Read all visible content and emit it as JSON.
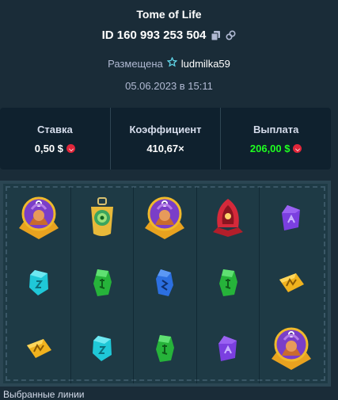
{
  "game": {
    "title": "Tome of Life",
    "bet_id": "ID 160 993 253 504",
    "placed_label": "Размещена",
    "user": "ludmilka59",
    "date": "05.06.2023 в 15:11"
  },
  "stats": {
    "bet_label": "Ставка",
    "bet_value": "0,50 $",
    "multiplier_label": "Коэффициент",
    "multiplier_value": "410,67×",
    "payout_label": "Выплата",
    "payout_value": "206,00 $"
  },
  "colors": {
    "background": "#1a2c38",
    "panel": "#0f212e",
    "payout_green": "#1fff20",
    "currency_red": "#e2263a"
  },
  "reels": [
    [
      "wizard-symbol",
      "eye-amulet-symbol",
      "wizard-symbol",
      "red-amulet-symbol",
      "purple-rune-symbol"
    ],
    [
      "cyan-rune-symbol",
      "green-rune-symbol",
      "blue-rune-symbol",
      "green-rune-symbol",
      "yellow-rune-symbol"
    ],
    [
      "yellow-rune-symbol",
      "cyan-rune-symbol",
      "green-rune-symbol",
      "purple-rune-symbol",
      "wizard-symbol"
    ]
  ],
  "footer": {
    "caption": "Выбранные линии"
  }
}
